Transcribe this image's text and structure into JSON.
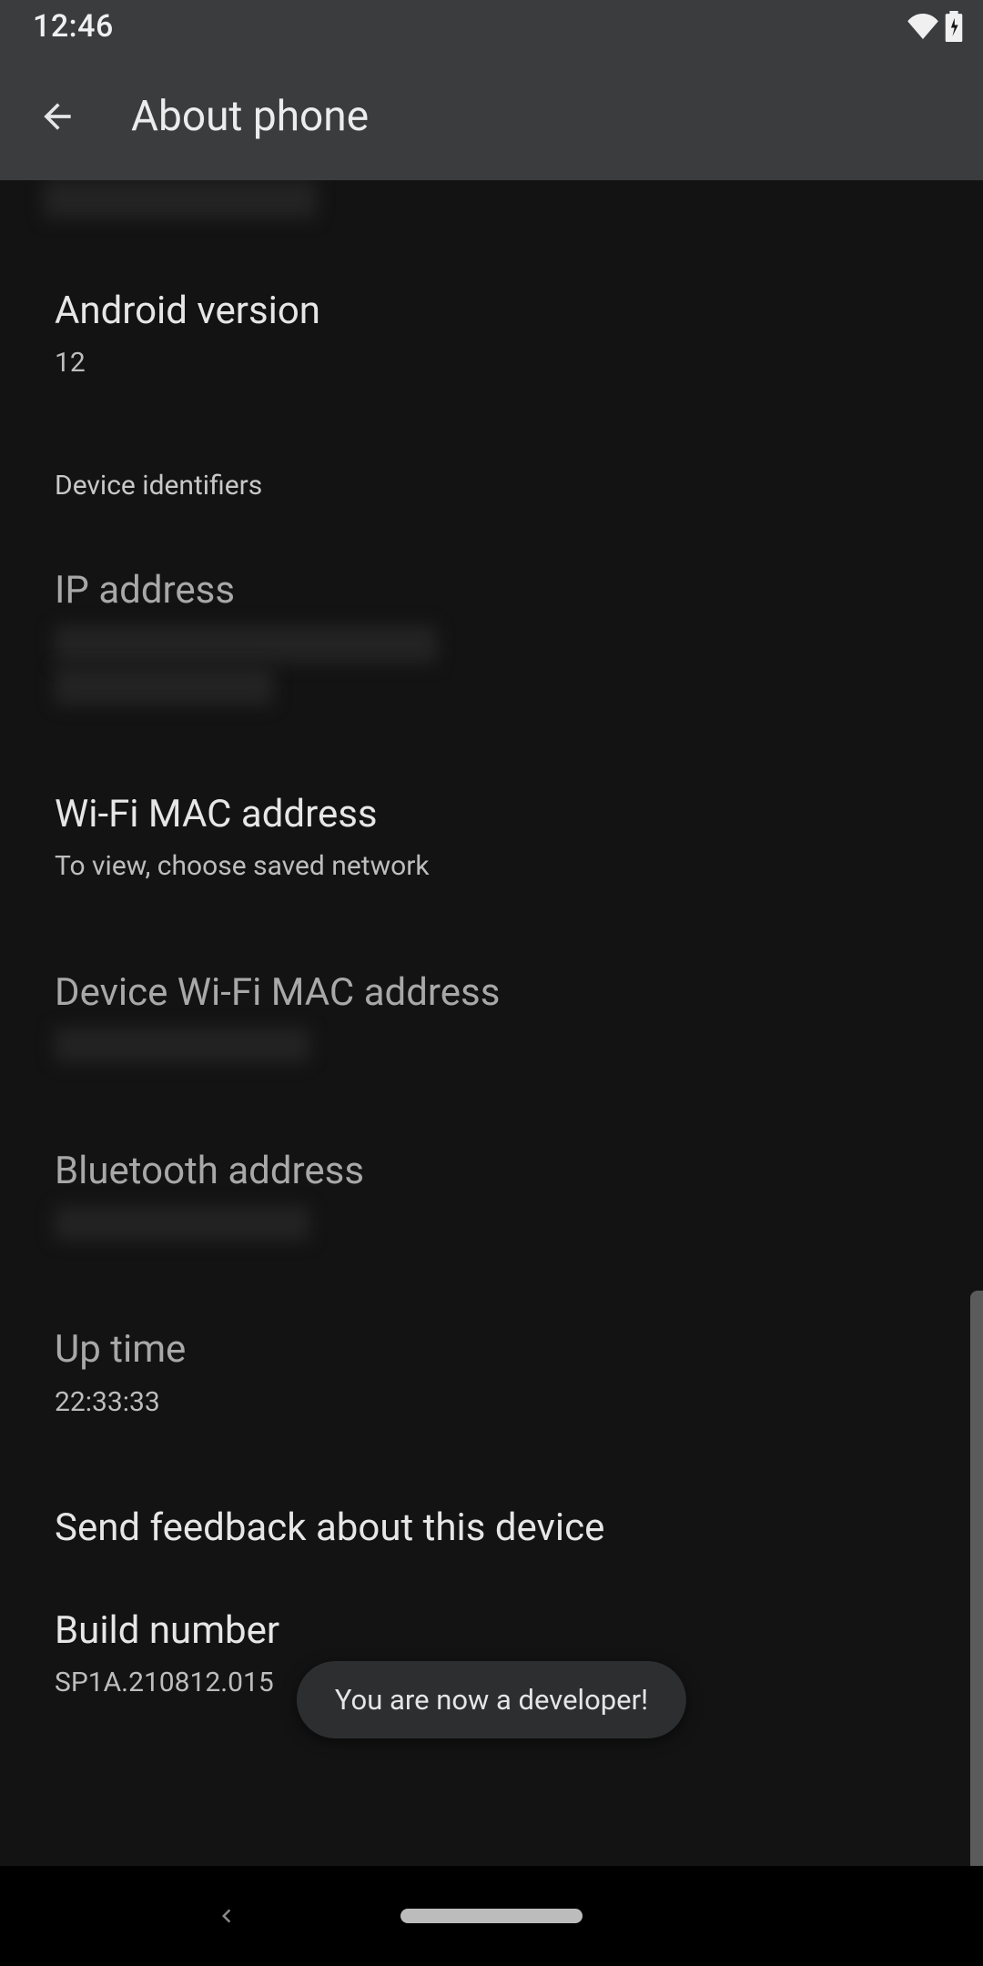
{
  "statusbar": {
    "clock": "12:46"
  },
  "appbar": {
    "title": "About phone"
  },
  "rows": {
    "android_version": {
      "title": "Android version",
      "value": "12"
    },
    "section_device_identifiers": "Device identifiers",
    "ip_address": {
      "title": "IP address"
    },
    "wifi_mac": {
      "title": "Wi-Fi MAC address",
      "value": "To view, choose saved network"
    },
    "device_wifi_mac": {
      "title": "Device Wi-Fi MAC address"
    },
    "bt_addr": {
      "title": "Bluetooth address"
    },
    "uptime": {
      "title": "Up time",
      "value": "22:33:33"
    },
    "feedback": {
      "title": "Send feedback about this device"
    },
    "build": {
      "title": "Build number",
      "value": "SP1A.210812.015"
    }
  },
  "toast": "You are now a developer!"
}
